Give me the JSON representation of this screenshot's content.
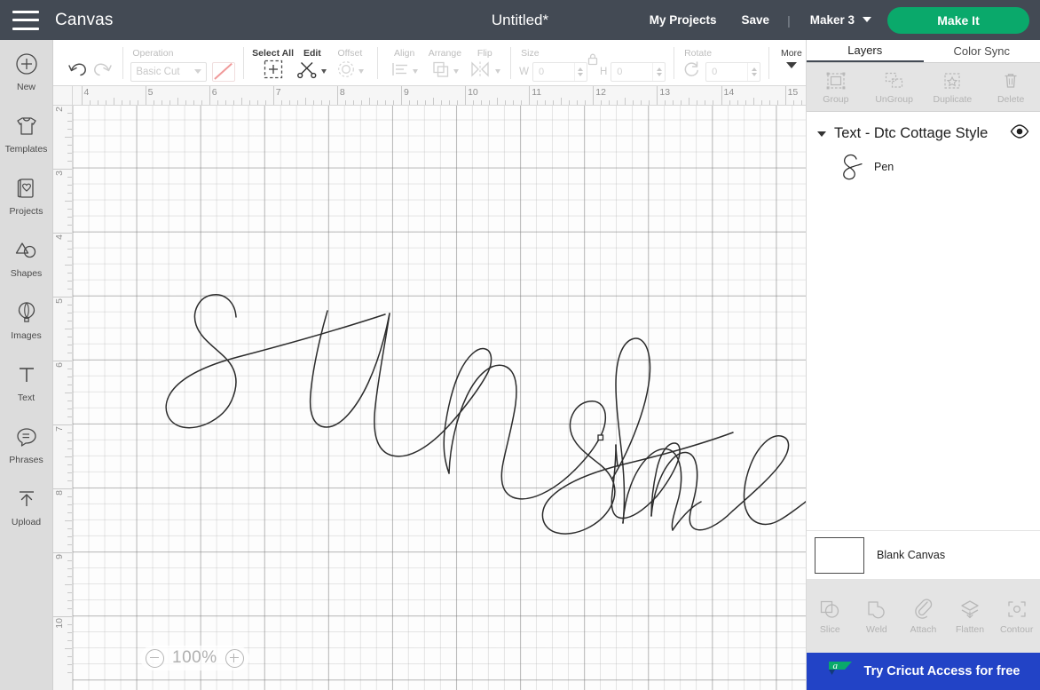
{
  "topbar": {
    "menu_icon": "hamburger-icon",
    "app_title": "Canvas",
    "document_title": "Untitled*",
    "my_projects": "My Projects",
    "save": "Save",
    "separator": "|",
    "machine": "Maker 3",
    "make_it": "Make It",
    "accent_green": "#0aa96b",
    "bar_bg": "#434a54"
  },
  "sidebar": {
    "items": [
      {
        "label": "New",
        "icon": "plus-circle-icon"
      },
      {
        "label": "Templates",
        "icon": "tshirt-icon"
      },
      {
        "label": "Projects",
        "icon": "card-heart-icon"
      },
      {
        "label": "Shapes",
        "icon": "shapes-icon"
      },
      {
        "label": "Images",
        "icon": "hot-air-balloon-icon"
      },
      {
        "label": "Text",
        "icon": "text-t-icon"
      },
      {
        "label": "Phrases",
        "icon": "speech-bubble-icon"
      },
      {
        "label": "Upload",
        "icon": "upload-arrow-icon"
      }
    ]
  },
  "toolbar": {
    "undo": "undo-icon",
    "redo": "redo-icon",
    "operation": {
      "label": "Operation",
      "value": "Basic Cut",
      "swatch_color": "#f09a9a",
      "disabled": true
    },
    "select_all": {
      "label": "Select All",
      "icon": "select-all-icon",
      "enabled": true
    },
    "edit": {
      "label": "Edit",
      "icon": "edit-scissors-icon",
      "enabled": true
    },
    "offset": {
      "label": "Offset",
      "icon": "offset-icon",
      "disabled": true
    },
    "align": {
      "label": "Align",
      "icon": "align-icon",
      "disabled": true
    },
    "arrange": {
      "label": "Arrange",
      "icon": "arrange-icon",
      "disabled": true
    },
    "flip": {
      "label": "Flip",
      "icon": "flip-icon",
      "disabled": true
    },
    "size": {
      "label": "Size",
      "lock_icon": "lock-icon",
      "width_label": "W",
      "width_value": "0",
      "height_label": "H",
      "height_value": "0"
    },
    "rotate": {
      "label": "Rotate",
      "value": "0",
      "icon": "rotate-icon"
    },
    "more": {
      "label": "More",
      "icon": "chevron-down-icon"
    }
  },
  "canvas": {
    "ruler_h_labels": [
      "4",
      "5",
      "6",
      "7",
      "8",
      "9",
      "10",
      "11",
      "12",
      "13",
      "14",
      "15"
    ],
    "ruler_v_labels": [
      "2",
      "3",
      "4",
      "5",
      "6",
      "7",
      "8",
      "9",
      "10"
    ],
    "zoom": {
      "level": "100%",
      "minus_icon": "minus-circle-icon",
      "plus_icon": "plus-circle-icon"
    },
    "artwork_text": "sunshine",
    "artwork_style": "script",
    "artwork_stroke": "#2b2b2b"
  },
  "right_panel": {
    "tabs": [
      {
        "label": "Layers",
        "active": true
      },
      {
        "label": "Color Sync",
        "active": false
      }
    ],
    "operations": [
      {
        "label": "Group",
        "icon": "group-icon"
      },
      {
        "label": "UnGroup",
        "icon": "ungroup-icon"
      },
      {
        "label": "Duplicate",
        "icon": "duplicate-icon"
      },
      {
        "label": "Delete",
        "icon": "trash-icon"
      }
    ],
    "layer_group": {
      "title": "Text - Dtc Cottage Style",
      "expand_icon": "triangle-down-icon",
      "visibility_icon": "eye-icon"
    },
    "layers": [
      {
        "name": "Pen",
        "thumb_icon": "script-glyph-icon"
      }
    ],
    "blank_canvas": {
      "label": "Blank Canvas",
      "swatch": "#ffffff"
    },
    "bottom_tools": [
      {
        "label": "Slice",
        "icon": "slice-icon"
      },
      {
        "label": "Weld",
        "icon": "weld-icon"
      },
      {
        "label": "Attach",
        "icon": "paperclip-icon"
      },
      {
        "label": "Flatten",
        "icon": "flatten-icon"
      },
      {
        "label": "Contour",
        "icon": "contour-icon"
      }
    ],
    "promo": {
      "text": "Try Cricut Access for free",
      "bg": "#2243c6",
      "mark_color": "#0aa96b",
      "icon": "cricut-logo-icon"
    }
  }
}
